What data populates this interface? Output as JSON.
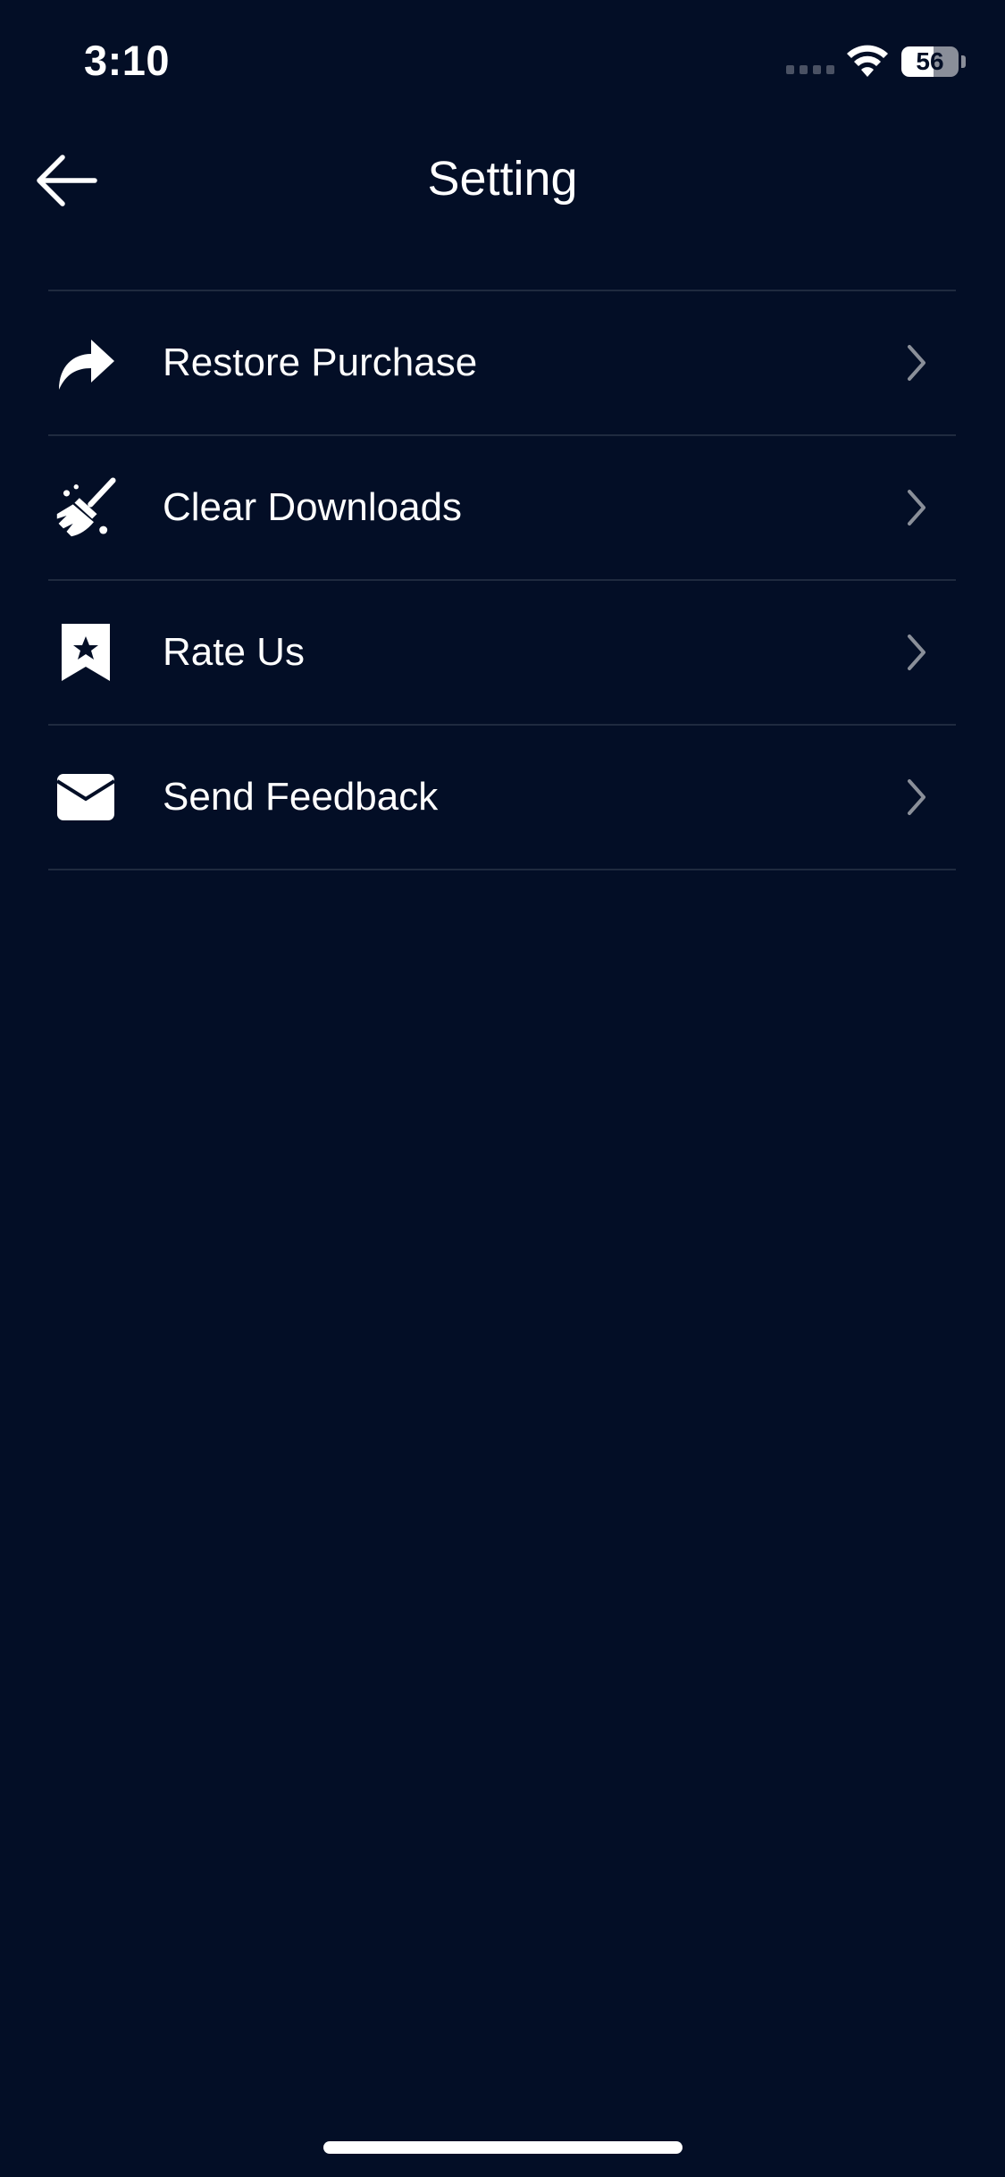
{
  "status_bar": {
    "time": "3:10",
    "battery": "56"
  },
  "nav": {
    "title": "Setting",
    "back_icon": "arrow-left-icon"
  },
  "menu": {
    "items": [
      {
        "label": "Restore Purchase",
        "icon": "share-arrow-icon"
      },
      {
        "label": "Clear Downloads",
        "icon": "broom-icon"
      },
      {
        "label": "Rate Us",
        "icon": "star-bookmark-icon"
      },
      {
        "label": "Send Feedback",
        "icon": "envelope-icon"
      }
    ],
    "chevron_icon": "chevron-right-icon"
  },
  "colors": {
    "background": "#030e26",
    "text": "#ffffff",
    "divider": "#1f2a3f",
    "chevron": "#8a8f99"
  }
}
